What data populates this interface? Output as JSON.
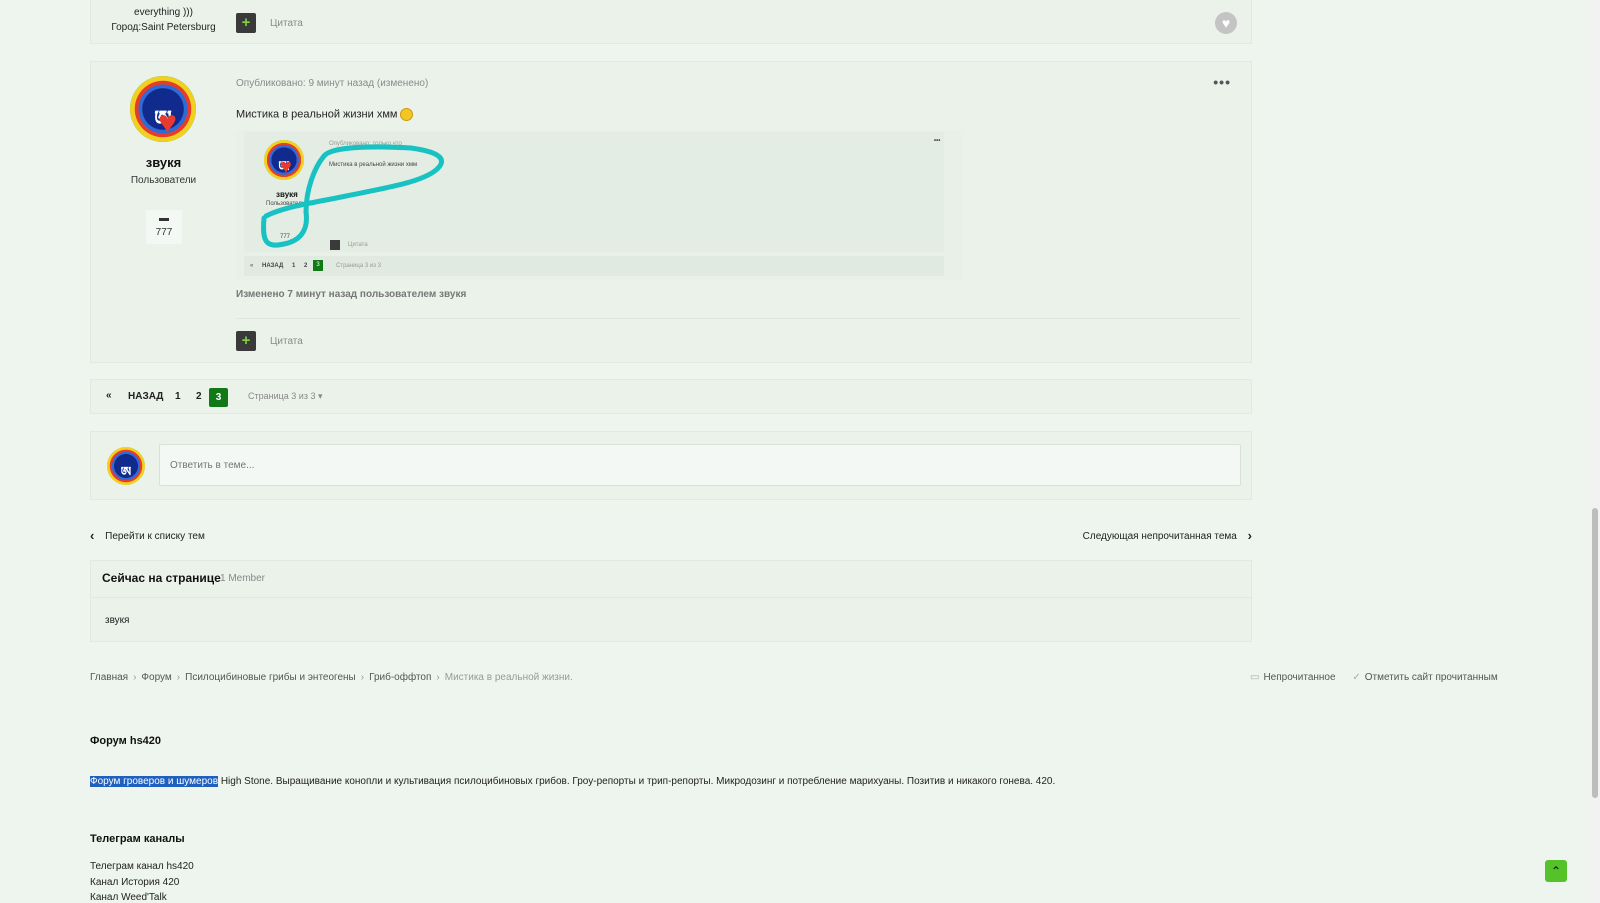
{
  "prev_post": {
    "bio": "everything )))",
    "city": "Город:Saint Petersburg",
    "quote_label": "Цитата"
  },
  "post": {
    "author": "звукя",
    "role": "Пользователи",
    "post_count": "777",
    "meta": "Опубликовано: 9 минут назад (изменено)",
    "text": "Мистика в реальной жизни хмм",
    "edited": "Изменено 7 минут назад пользователем звукя",
    "quote_label": "Цитата",
    "screenshot": {
      "meta": "Опубликовано: только что",
      "text": "Мистика в реальной жизни хмм",
      "author": "звукя",
      "role": "Пользователи",
      "count": "777",
      "quote": "Цитата",
      "back": "НАЗАД",
      "p1": "1",
      "p2": "2",
      "p3": "3",
      "page_of": "Страница 3 из 3"
    }
  },
  "pagination": {
    "first": "«",
    "back": "НАЗАД",
    "pages": [
      "1",
      "2"
    ],
    "current": "3",
    "page_of": "Страница 3 из 3"
  },
  "reply": {
    "placeholder": "Ответить в теме..."
  },
  "topic_nav": {
    "prev": "Перейти к списку тем",
    "next": "Следующая непрочитанная тема"
  },
  "online": {
    "title": "Сейчас на странице",
    "count": "1 Member",
    "user": "звукя"
  },
  "breadcrumbs": [
    "Главная",
    "Форум",
    "Псилоцибиновые грибы и энтеогены",
    "Гриб-оффтоп",
    "Мистика в реальной жизни."
  ],
  "footer_links": {
    "unread": "Непрочитанное",
    "mark_read": "Отметить сайт прочитанным"
  },
  "footer": {
    "forum_title": "Форум hs420",
    "selected_text": "Форум гроверов и шумеров",
    "description": " High Stone. Выращивание конопли и культивация псилоцибиновых грибов. Гроу-репорты и трип-репорты. Микродозинг и потребление марихуаны. Позитив и никакого гонева. 420.",
    "telegram_title": "Телеграм каналы",
    "telegram_links": [
      "Телеграм канал hs420",
      "Канал История 420",
      "Канал Weed'Talk"
    ]
  },
  "icons": {
    "plus": "+",
    "heart": "♥",
    "comment": "💬",
    "chevron_left": "‹",
    "chevron_right": "›",
    "up": "⌃"
  },
  "colors": {
    "page_bg": "#eef5ee",
    "accent_green": "#117a16",
    "selection": "#1f5fbf"
  }
}
